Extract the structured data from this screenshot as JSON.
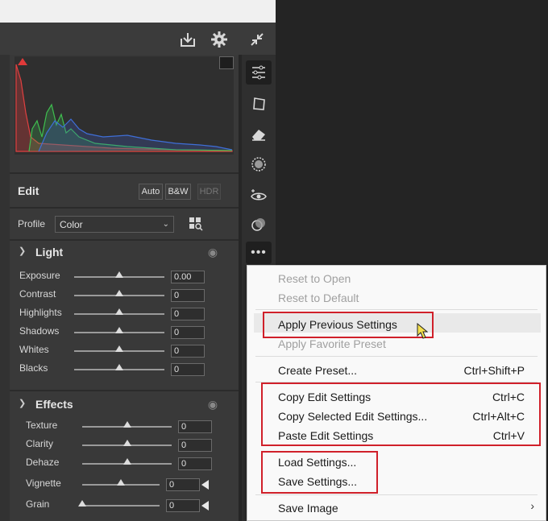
{
  "toolbar": {
    "icons": [
      "download-icon",
      "gear-icon",
      "collapse-icon"
    ]
  },
  "edit": {
    "title": "Edit",
    "auto": "Auto",
    "bw": "B&W",
    "hdr": "HDR"
  },
  "profile": {
    "label": "Profile",
    "value": "Color"
  },
  "light": {
    "title": "Light",
    "sliders": [
      {
        "label": "Exposure",
        "value": "0.00"
      },
      {
        "label": "Contrast",
        "value": "0"
      },
      {
        "label": "Highlights",
        "value": "0"
      },
      {
        "label": "Shadows",
        "value": "0"
      },
      {
        "label": "Whites",
        "value": "0"
      },
      {
        "label": "Blacks",
        "value": "0"
      }
    ]
  },
  "effects": {
    "title": "Effects",
    "sliders": [
      {
        "label": "Texture",
        "value": "0"
      },
      {
        "label": "Clarity",
        "value": "0"
      },
      {
        "label": "Dehaze",
        "value": "0"
      },
      {
        "label": "Vignette",
        "value": "0"
      },
      {
        "label": "Grain",
        "value": "0"
      }
    ]
  },
  "menu": {
    "items": [
      {
        "label": "Reset to Open",
        "shortcut": "",
        "disabled": true
      },
      {
        "label": "Reset to Default",
        "shortcut": "",
        "disabled": true
      },
      {
        "label": "Apply Previous Settings",
        "shortcut": "",
        "disabled": false
      },
      {
        "label": "Apply Favorite Preset",
        "shortcut": "",
        "disabled": true
      },
      {
        "label": "Create Preset...",
        "shortcut": "Ctrl+Shift+P",
        "disabled": false
      },
      {
        "label": "Copy Edit Settings",
        "shortcut": "Ctrl+C",
        "disabled": false
      },
      {
        "label": "Copy Selected Edit Settings...",
        "shortcut": "Ctrl+Alt+C",
        "disabled": false
      },
      {
        "label": "Paste Edit Settings",
        "shortcut": "Ctrl+V",
        "disabled": false
      },
      {
        "label": "Load Settings...",
        "shortcut": "",
        "disabled": false
      },
      {
        "label": "Save Settings...",
        "shortcut": "",
        "disabled": false
      },
      {
        "label": "Save Image",
        "shortcut": "",
        "disabled": false
      }
    ]
  },
  "colors": {
    "highlight_box": "#d0202a",
    "panel": "#393939",
    "menu_bg": "#f9f9f9"
  }
}
